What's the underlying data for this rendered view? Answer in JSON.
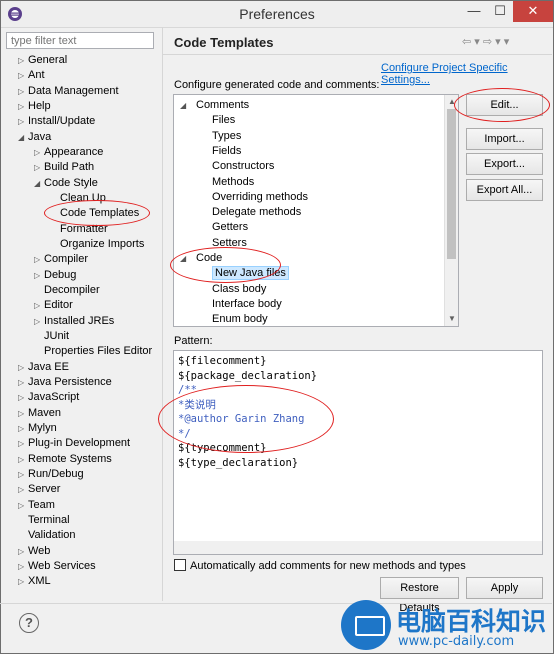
{
  "window": {
    "title": "Preferences",
    "minimize": "—",
    "maximize": "☐",
    "close": "✕"
  },
  "filter": {
    "placeholder": "type filter text"
  },
  "nav_tree": [
    {
      "label": "General",
      "level": 0,
      "arrow": "▷"
    },
    {
      "label": "Ant",
      "level": 0,
      "arrow": "▷"
    },
    {
      "label": "Data Management",
      "level": 0,
      "arrow": "▷"
    },
    {
      "label": "Help",
      "level": 0,
      "arrow": "▷"
    },
    {
      "label": "Install/Update",
      "level": 0,
      "arrow": "▷"
    },
    {
      "label": "Java",
      "level": 0,
      "arrow": "◢"
    },
    {
      "label": "Appearance",
      "level": 1,
      "arrow": "▷"
    },
    {
      "label": "Build Path",
      "level": 1,
      "arrow": "▷"
    },
    {
      "label": "Code Style",
      "level": 1,
      "arrow": "◢"
    },
    {
      "label": "Clean Up",
      "level": 2,
      "arrow": ""
    },
    {
      "label": "Code Templates",
      "level": 2,
      "arrow": ""
    },
    {
      "label": "Formatter",
      "level": 2,
      "arrow": ""
    },
    {
      "label": "Organize Imports",
      "level": 2,
      "arrow": ""
    },
    {
      "label": "Compiler",
      "level": 1,
      "arrow": "▷"
    },
    {
      "label": "Debug",
      "level": 1,
      "arrow": "▷"
    },
    {
      "label": "Decompiler",
      "level": 1,
      "arrow": ""
    },
    {
      "label": "Editor",
      "level": 1,
      "arrow": "▷"
    },
    {
      "label": "Installed JREs",
      "level": 1,
      "arrow": "▷"
    },
    {
      "label": "JUnit",
      "level": 1,
      "arrow": ""
    },
    {
      "label": "Properties Files Editor",
      "level": 1,
      "arrow": ""
    },
    {
      "label": "Java EE",
      "level": 0,
      "arrow": "▷"
    },
    {
      "label": "Java Persistence",
      "level": 0,
      "arrow": "▷"
    },
    {
      "label": "JavaScript",
      "level": 0,
      "arrow": "▷"
    },
    {
      "label": "Maven",
      "level": 0,
      "arrow": "▷"
    },
    {
      "label": "Mylyn",
      "level": 0,
      "arrow": "▷"
    },
    {
      "label": "Plug-in Development",
      "level": 0,
      "arrow": "▷"
    },
    {
      "label": "Remote Systems",
      "level": 0,
      "arrow": "▷"
    },
    {
      "label": "Run/Debug",
      "level": 0,
      "arrow": "▷"
    },
    {
      "label": "Server",
      "level": 0,
      "arrow": "▷"
    },
    {
      "label": "Team",
      "level": 0,
      "arrow": "▷"
    },
    {
      "label": "Terminal",
      "level": 0,
      "arrow": ""
    },
    {
      "label": "Validation",
      "level": 0,
      "arrow": ""
    },
    {
      "label": "Web",
      "level": 0,
      "arrow": "▷"
    },
    {
      "label": "Web Services",
      "level": 0,
      "arrow": "▷"
    },
    {
      "label": "XML",
      "level": 0,
      "arrow": "▷"
    }
  ],
  "page": {
    "title": "Code Templates",
    "nav_icons": "⇦ ▾ ⇨ ▾ ▾",
    "link": "Configure Project Specific Settings...",
    "config_label": "Configure generated code and comments:"
  },
  "template_tree": [
    {
      "label": "Comments",
      "level": 0,
      "arrow": "◢"
    },
    {
      "label": "Files",
      "level": 1,
      "arrow": ""
    },
    {
      "label": "Types",
      "level": 1,
      "arrow": ""
    },
    {
      "label": "Fields",
      "level": 1,
      "arrow": ""
    },
    {
      "label": "Constructors",
      "level": 1,
      "arrow": ""
    },
    {
      "label": "Methods",
      "level": 1,
      "arrow": ""
    },
    {
      "label": "Overriding methods",
      "level": 1,
      "arrow": ""
    },
    {
      "label": "Delegate methods",
      "level": 1,
      "arrow": ""
    },
    {
      "label": "Getters",
      "level": 1,
      "arrow": ""
    },
    {
      "label": "Setters",
      "level": 1,
      "arrow": ""
    },
    {
      "label": "Code",
      "level": 0,
      "arrow": "◢"
    },
    {
      "label": "New Java files",
      "level": 1,
      "arrow": ""
    },
    {
      "label": "Class body",
      "level": 1,
      "arrow": ""
    },
    {
      "label": "Interface body",
      "level": 1,
      "arrow": ""
    },
    {
      "label": "Enum body",
      "level": 1,
      "arrow": ""
    }
  ],
  "buttons": {
    "edit": "Edit...",
    "import": "Import...",
    "export": "Export...",
    "export_all": "Export All...",
    "restore_defaults": "Restore Defaults",
    "apply": "Apply"
  },
  "pattern": {
    "label": "Pattern:",
    "lines": [
      {
        "text": "${filecomment}",
        "color": "#000000"
      },
      {
        "text": "${package_declaration}",
        "color": "#000000"
      },
      {
        "text": "/**",
        "color": "#3f5fbf"
      },
      {
        "text": "*类说明",
        "color": "#3f5fbf"
      },
      {
        "text": "*@author Garin Zhang",
        "color": "#3f5fbf"
      },
      {
        "text": "*/",
        "color": "#3f5fbf"
      },
      {
        "text": "${typecomment}",
        "color": "#000000"
      },
      {
        "text": "${type_declaration}",
        "color": "#000000"
      }
    ]
  },
  "checkbox": {
    "label": "Automatically add comments for new methods and types",
    "checked": false
  },
  "help": "?",
  "watermark": {
    "text": "电脑百科知识",
    "url": "www.pc-daily.com"
  },
  "colors": {
    "accent": "#e02020",
    "selection": "#cde8ff",
    "link": "#0066cc",
    "comment": "#3f5fbf"
  }
}
